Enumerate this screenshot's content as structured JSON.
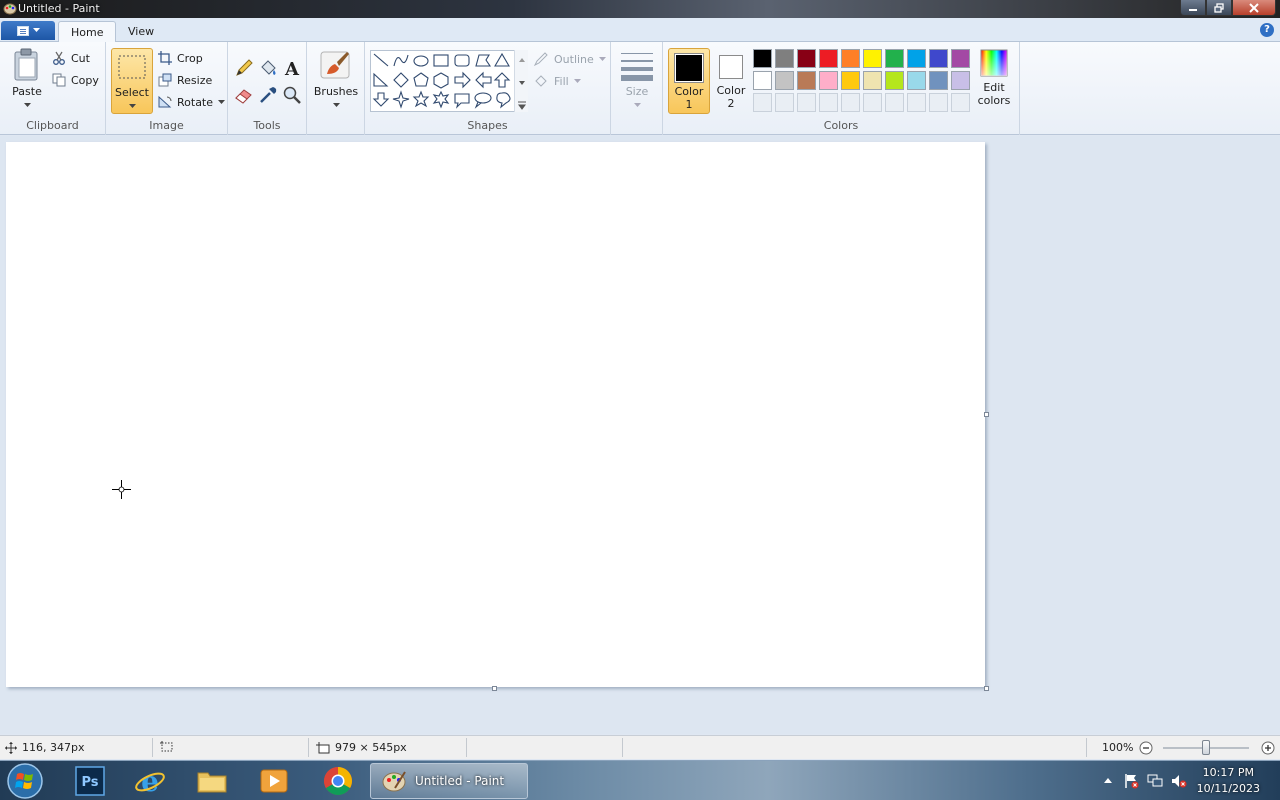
{
  "window": {
    "title": "Untitled - Paint"
  },
  "tabs": {
    "home": "Home",
    "view": "View"
  },
  "ribbon": {
    "clipboard": {
      "label": "Clipboard",
      "paste": "Paste",
      "cut": "Cut",
      "copy": "Copy"
    },
    "image": {
      "label": "Image",
      "select": "Select",
      "crop": "Crop",
      "resize": "Resize",
      "rotate": "Rotate"
    },
    "tools": {
      "label": "Tools"
    },
    "brushes": {
      "label": "Brushes"
    },
    "shapes": {
      "label": "Shapes",
      "outline": "Outline",
      "fill": "Fill"
    },
    "size": {
      "label": "Size"
    },
    "colors": {
      "label": "Colors",
      "color1_a": "Color",
      "color1_b": "1",
      "color2_a": "Color",
      "color2_b": "2",
      "edit_a": "Edit",
      "edit_b": "colors",
      "color1": "#000000",
      "color2": "#ffffff",
      "row1": [
        "#000000",
        "#7f7f7f",
        "#880015",
        "#ed1c24",
        "#ff7f27",
        "#fff200",
        "#22b14c",
        "#00a2e8",
        "#3f48cc",
        "#a349a4"
      ],
      "row2": [
        "#ffffff",
        "#c3c3c3",
        "#b97a57",
        "#ffaec9",
        "#ffc90e",
        "#efe4b0",
        "#b5e61d",
        "#99d9ea",
        "#7092be",
        "#c8bfe7"
      ]
    }
  },
  "status": {
    "cursor_pos": "116, 347px",
    "canvas_size": "979 × 545px",
    "zoom": "100%",
    "zoom_fraction": 0.5
  },
  "taskbar": {
    "paint_task": "Untitled - Paint",
    "time": "10:17 PM",
    "date": "10/11/2023"
  }
}
